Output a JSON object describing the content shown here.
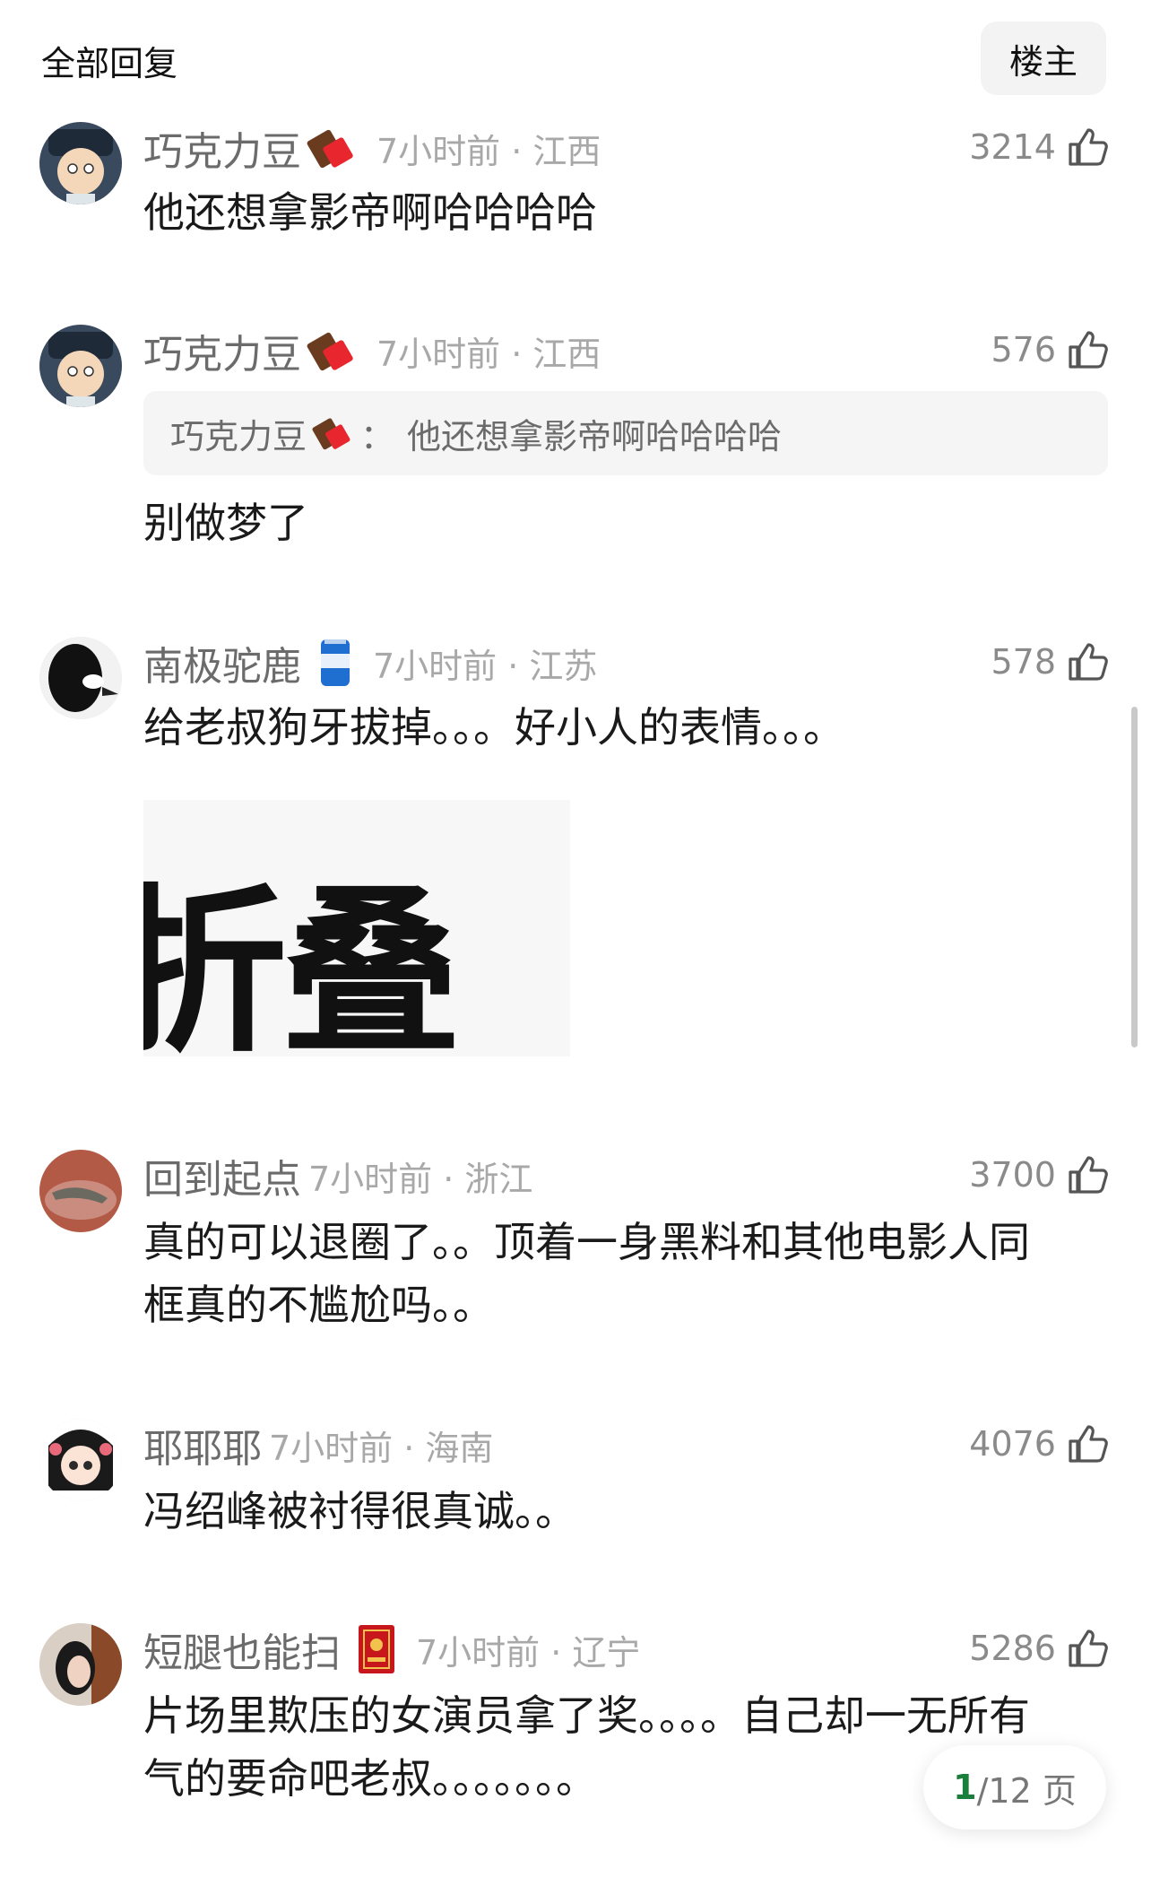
{
  "header": {
    "title": "全部回复",
    "op_button": "楼主"
  },
  "comments": [
    {
      "username": "巧克力豆",
      "badge": "chocolate-icon",
      "time_location": "7小时前 · 江西",
      "likes": "3214",
      "text": "他还想拿影帝啊哈哈哈哈"
    },
    {
      "username": "巧克力豆",
      "badge": "chocolate-icon",
      "time_location": "7小时前 · 江西",
      "likes": "576",
      "quote": {
        "user": "巧克力豆",
        "sep": "：",
        "text": "他还想拿影帝啊哈哈哈哈"
      },
      "text": "别做梦了"
    },
    {
      "username": "南极驼鹿",
      "badge": "soda-can-icon",
      "time_location": "7小时前 · 江苏",
      "likes": "578",
      "text": "给老叔狗牙拔掉。。。好小人的表情。。。",
      "sticker_text": "折叠"
    },
    {
      "username": "回到起点",
      "time_location": "7小时前 · 浙江",
      "likes": "3700",
      "text_lines": [
        "真的可以退圈了。。顶着一身黑料和其他电影人同",
        "框真的不尴尬吗。。"
      ]
    },
    {
      "username": "耶耶耶",
      "time_location": "7小时前 · 海南",
      "likes": "4076",
      "text": "冯绍峰被衬得很真诚。。"
    },
    {
      "username": "短腿也能扫",
      "badge": "red-book-icon",
      "time_location": "7小时前 · 辽宁",
      "likes": "5286",
      "text_lines": [
        "片场里欺压的女演员拿了奖。。。。自己却一无所有",
        "气的要命吧老叔。。。。。。。"
      ]
    }
  ],
  "pager": {
    "current": "1",
    "total": "/12 页"
  },
  "colors": {
    "accent_green": "#1a7f3b",
    "muted_text": "#6b6b6b",
    "quote_bg": "#f5f5f5"
  }
}
